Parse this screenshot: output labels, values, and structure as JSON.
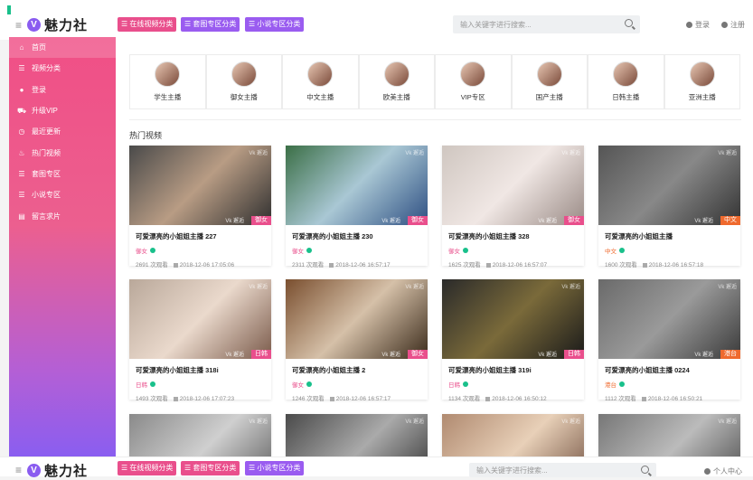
{
  "header": {
    "logo_badge": "V",
    "logo_text": "魅力社",
    "menu_icon": "≡",
    "categories": [
      {
        "label": "☰ 在线视频分类",
        "color": "#e94f8c"
      },
      {
        "label": "☰ 套图专区分类",
        "color": "#9a5cf0"
      },
      {
        "label": "☰ 小说专区分类",
        "color": "#9a5cf0"
      }
    ],
    "search_placeholder": "输入关键字进行搜索...",
    "login": "登录",
    "register": "注册"
  },
  "sidebar": {
    "items": [
      {
        "icon": "home-icon",
        "glyph": "⌂",
        "label": "首页"
      },
      {
        "icon": "list-icon",
        "glyph": "☰",
        "label": "视频分类"
      },
      {
        "icon": "user-icon",
        "glyph": "●",
        "label": "登录"
      },
      {
        "icon": "cart-icon",
        "glyph": "⛟",
        "label": "升级VIP"
      },
      {
        "icon": "clock-icon",
        "glyph": "◷",
        "label": "最近更新"
      },
      {
        "icon": "fire-icon",
        "glyph": "♨",
        "label": "热门视频"
      },
      {
        "icon": "list-icon",
        "glyph": "☰",
        "label": "套图专区"
      },
      {
        "icon": "list-icon",
        "glyph": "☰",
        "label": "小说专区"
      },
      {
        "icon": "doc-icon",
        "glyph": "▤",
        "label": "留言求片"
      }
    ]
  },
  "categories": [
    {
      "label": "学生主播"
    },
    {
      "label": "御女主播"
    },
    {
      "label": "中文主播"
    },
    {
      "label": "欧美主播"
    },
    {
      "label": "VIP专区"
    },
    {
      "label": "国产主播"
    },
    {
      "label": "日韩主播"
    },
    {
      "label": "亚洲主播"
    }
  ],
  "section_title": "热门视频",
  "watermark": "Vk 邂逅",
  "videos": [
    {
      "title": "可爱漂亮的小姐姐主播 227",
      "tag": "御女",
      "tag_color": "#e94f8c",
      "views": "2691 次观看",
      "date": "2018-12-06 17:05:06",
      "colors": [
        "#4a4a4a",
        "#b89c84",
        "#2f2f2f"
      ]
    },
    {
      "title": "可爱漂亮的小姐姐主播 230",
      "tag": "御女",
      "tag_color": "#e94f8c",
      "views": "2311 次观看",
      "date": "2018-12-06 16:57:17",
      "colors": [
        "#3b6f46",
        "#a9c7d4",
        "#2e4f82"
      ]
    },
    {
      "title": "可爱漂亮的小姐姐主播 328",
      "tag": "御女",
      "tag_color": "#e94f8c",
      "views": "1625 次观看",
      "date": "2018-12-06 16:57:07",
      "colors": [
        "#cfc6c0",
        "#f0e7e4",
        "#9a8b86"
      ]
    },
    {
      "title": "可爱漂亮的小姐姐主播",
      "tag": "中文",
      "tag_color": "#ef6a2e",
      "views": "1600 次观看",
      "date": "2018-12-06 16:57:18",
      "colors": [
        "#555",
        "#888",
        "#333"
      ]
    },
    {
      "title": "可爱漂亮的小姐姐主播 318i",
      "tag": "日韩",
      "tag_color": "#e94f8c",
      "views": "1493 次观看",
      "date": "2018-12-06 17:07:23",
      "colors": [
        "#b9a89a",
        "#ead9cc",
        "#7a5a4a"
      ]
    },
    {
      "title": "可爱漂亮的小姐姐主播 2",
      "tag": "御女",
      "tag_color": "#e94f8c",
      "views": "1246 次观看",
      "date": "2018-12-06 16:57:17",
      "colors": [
        "#7a4f2f",
        "#d5c0a8",
        "#3a2a1a"
      ]
    },
    {
      "title": "可爱漂亮的小姐姐主播 319i",
      "tag": "日韩",
      "tag_color": "#e94f8c",
      "views": "1134 次观看",
      "date": "2018-12-06 16:50:12",
      "colors": [
        "#2a2a2a",
        "#7a6a3a",
        "#1a1a1a"
      ]
    },
    {
      "title": "可爱漂亮的小姐姐主播 0224",
      "tag": "港台",
      "tag_color": "#ef6a2e",
      "views": "1112 次观看",
      "date": "2018-12-06 16:50:21",
      "colors": [
        "#6a6a6a",
        "#9a9a9a",
        "#3a3a3a"
      ]
    },
    {
      "title": "",
      "tag": "",
      "tag_color": "#e94f8c",
      "views": "",
      "date": "",
      "colors": [
        "#8a8a8a",
        "#cfcfcf",
        "#555"
      ]
    },
    {
      "title": "",
      "tag": "",
      "tag_color": "#e94f8c",
      "views": "",
      "date": "",
      "colors": [
        "#4a4a4a",
        "#aaaaaa",
        "#2a2a2a"
      ]
    },
    {
      "title": "",
      "tag": "",
      "tag_color": "#e94f8c",
      "views": "",
      "date": "",
      "colors": [
        "#b08a70",
        "#e8d0b8",
        "#6a4a3a"
      ]
    },
    {
      "title": "",
      "tag": "",
      "tag_color": "#e94f8c",
      "views": "",
      "date": "",
      "colors": [
        "#777",
        "#bbb",
        "#444"
      ]
    }
  ],
  "footer_user": "个人中心"
}
